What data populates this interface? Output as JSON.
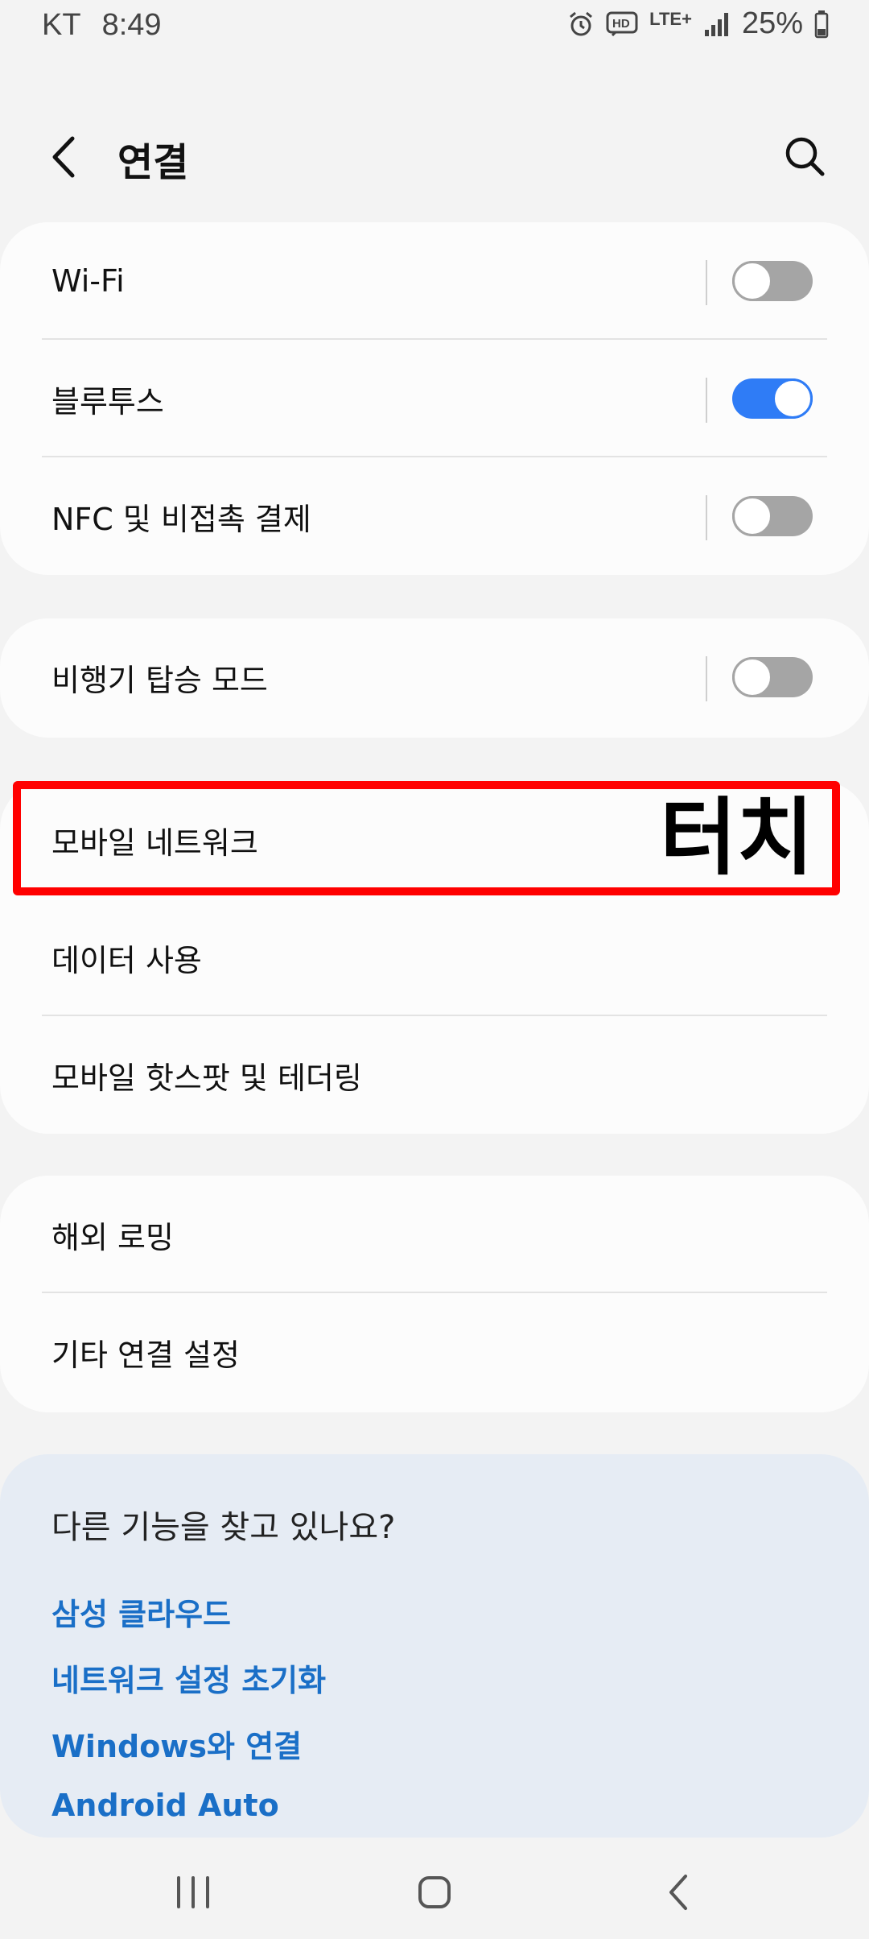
{
  "status_bar": {
    "carrier": "KT",
    "time": "8:49",
    "network": "LTE+",
    "battery": "25%"
  },
  "header": {
    "title": "연결"
  },
  "groups": {
    "wireless": [
      {
        "label": "Wi-Fi",
        "toggle": false
      },
      {
        "label": "블루투스",
        "toggle": true
      },
      {
        "label": "NFC 및 비접촉 결제",
        "toggle": false
      }
    ],
    "airplane": [
      {
        "label": "비행기 탑승 모드",
        "toggle": false
      }
    ],
    "mobile": [
      {
        "label": "모바일 네트워크"
      },
      {
        "label": "데이터 사용"
      },
      {
        "label": "모바일 핫스팟 및 테더링"
      }
    ],
    "other": [
      {
        "label": "해외 로밍"
      },
      {
        "label": "기타 연결 설정"
      }
    ]
  },
  "annotation": {
    "text": "터치",
    "color": "#ff0000"
  },
  "suggestions": {
    "title": "다른 기능을 찾고 있나요?",
    "links": [
      "삼성 클라우드",
      "네트워크 설정 초기화",
      "Windows와 연결",
      "Android Auto"
    ]
  },
  "colors": {
    "toggle_on": "#2f7cf6",
    "toggle_off": "#a5a5a5",
    "link": "#1a6fc7",
    "suggest_bg": "#e6ecf4"
  },
  "icons": {
    "back": "chevron-left-icon",
    "search": "search-icon",
    "alarm": "alarm-icon",
    "hd": "hd-voice-icon",
    "signal": "signal-icon",
    "battery": "battery-icon",
    "nav_recent": "recent-apps-icon",
    "nav_home": "home-icon",
    "nav_back": "back-icon"
  }
}
